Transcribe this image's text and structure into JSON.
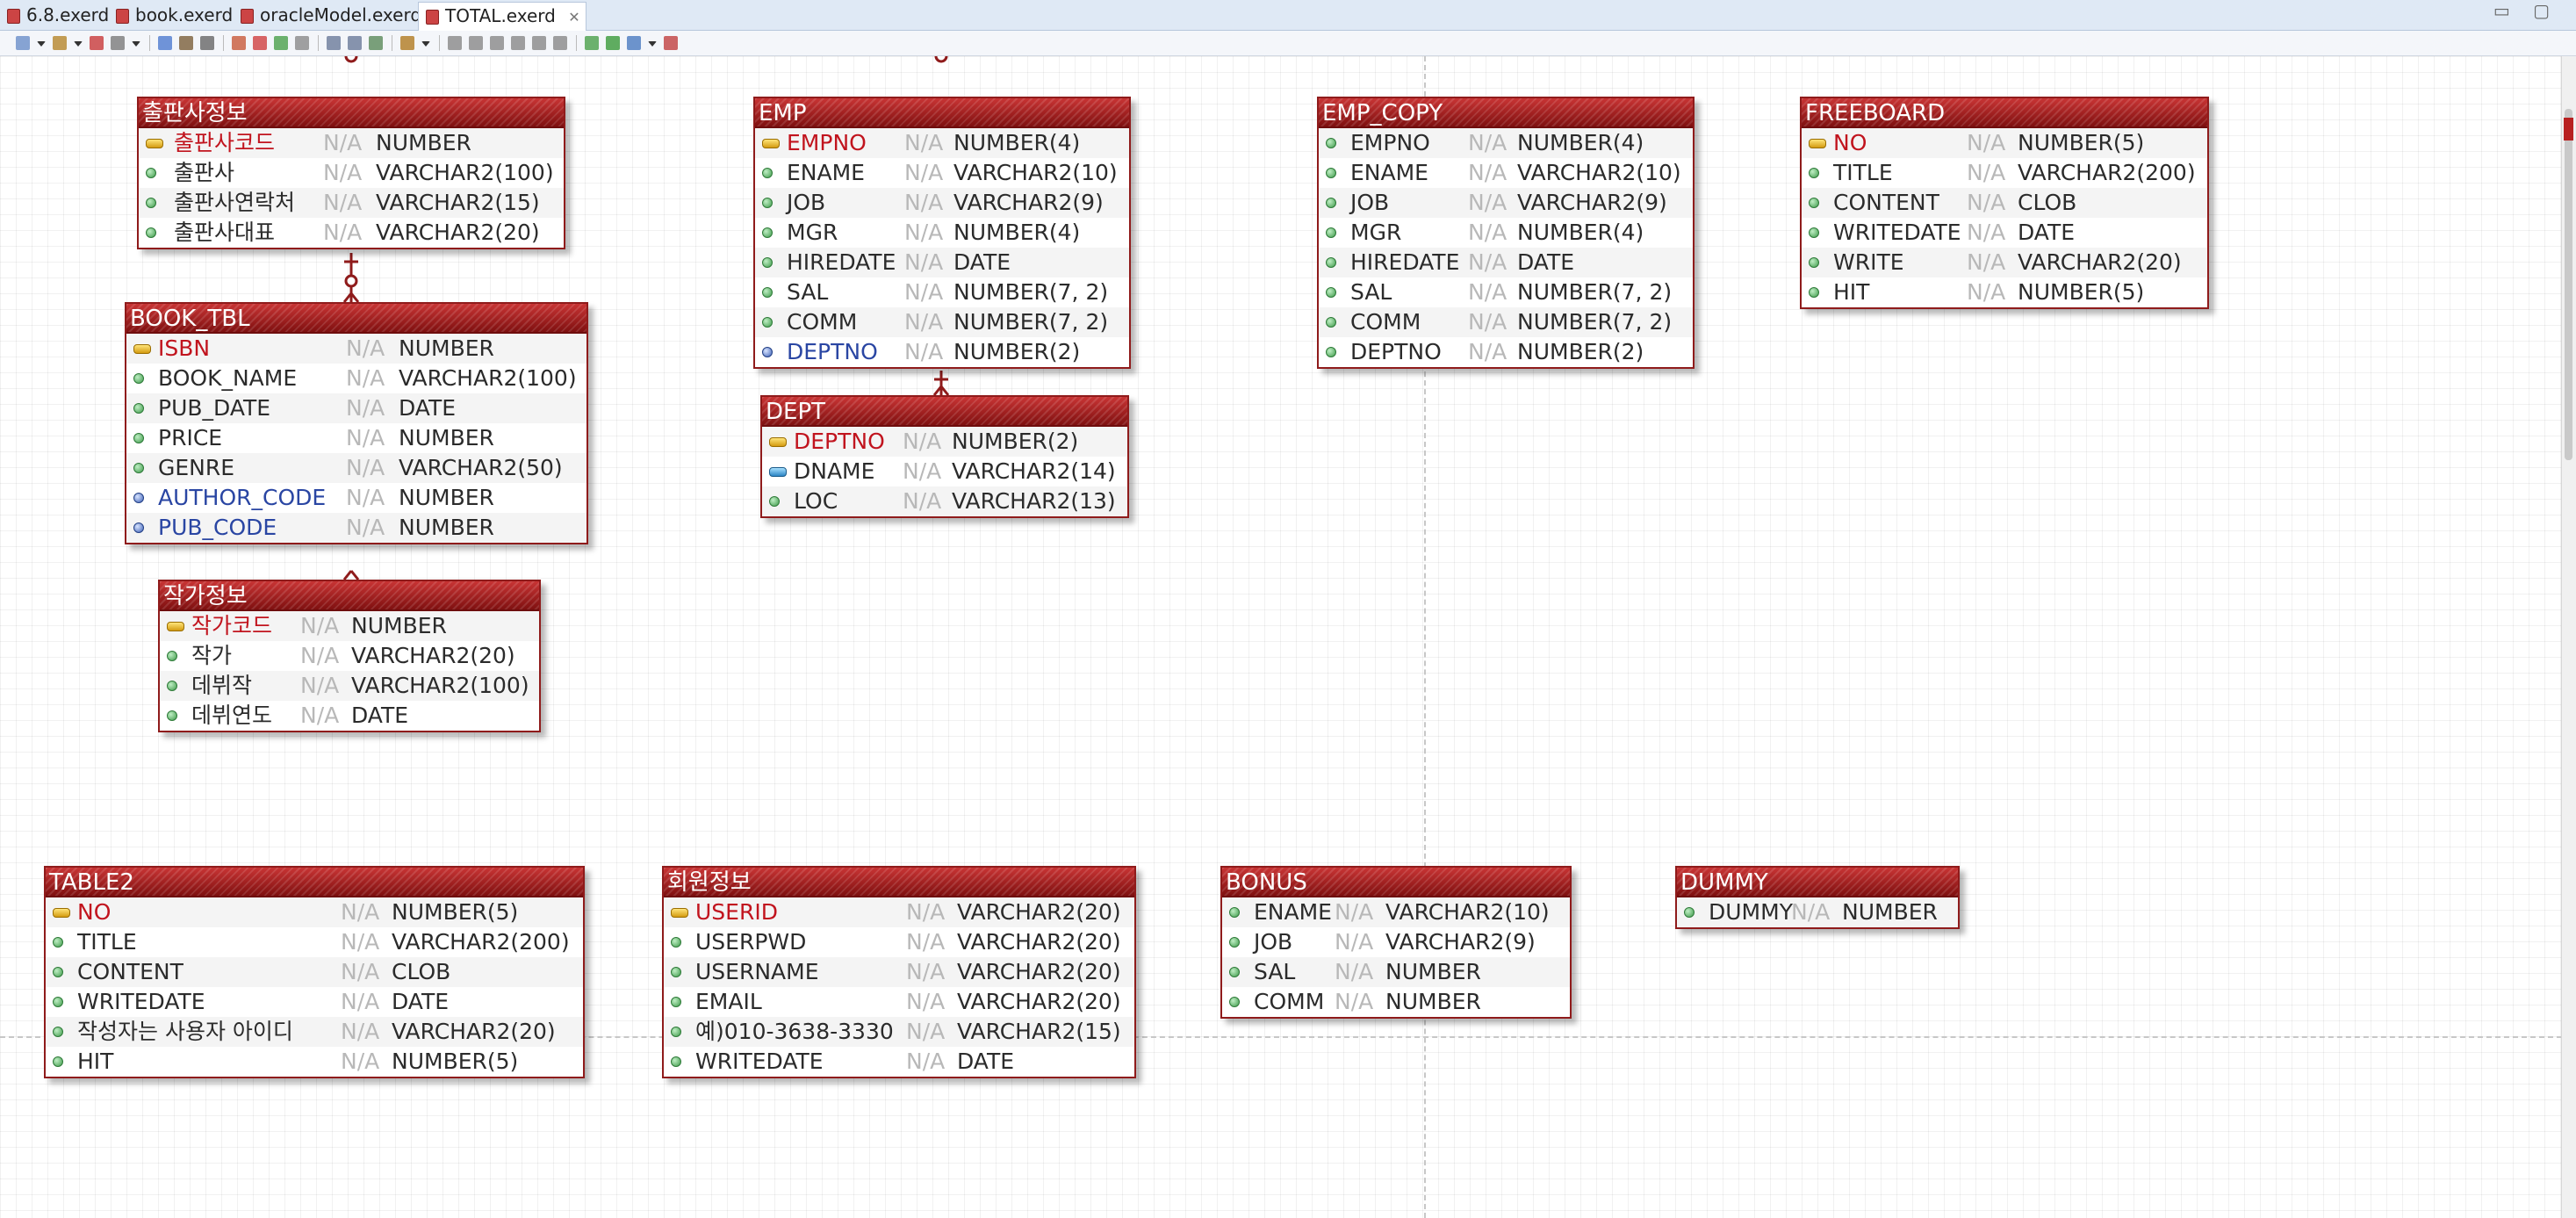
{
  "tabs": [
    {
      "label": "6.8.exerd",
      "active": false
    },
    {
      "label": "book.exerd",
      "active": false
    },
    {
      "label": "oracleModel.exerd",
      "active": false
    },
    {
      "label": "TOTAL.exerd",
      "active": true
    }
  ],
  "tab_close_glyph": "✕",
  "window_controls": "▭ ▢",
  "toolbar_icons": [
    "new-icon",
    "dropdown-icon",
    "connect-icon",
    "dropdown-icon",
    "save-icon",
    "copy-icon",
    "dropdown-icon",
    "select-icon",
    "hand-icon",
    "zoom-icon",
    "table-icon",
    "relation-icon",
    "relation-icon",
    "note-icon",
    "print-icon",
    "print-preview-icon",
    "image-icon",
    "layout-icon",
    "dropdown-icon",
    "align-left-icon",
    "align-center-icon",
    "align-right-icon",
    "align-top-icon",
    "align-middle-icon",
    "align-bottom-icon",
    "export-icon",
    "generate-icon",
    "sync-icon",
    "dropdown-icon",
    "settings-icon"
  ],
  "null_label": "N/A",
  "entities": [
    {
      "id": "publisher",
      "title": "출판사정보",
      "columns": [
        {
          "key": "pk",
          "name": "출판사코드",
          "type": "NUMBER"
        },
        {
          "key": "attr",
          "name": "출판사",
          "type": "VARCHAR2(100)"
        },
        {
          "key": "attr",
          "name": "출판사연락처",
          "type": "VARCHAR2(15)"
        },
        {
          "key": "attr",
          "name": "출판사대표",
          "type": "VARCHAR2(20)"
        }
      ]
    },
    {
      "id": "book-tbl",
      "title": "BOOK_TBL",
      "columns": [
        {
          "key": "pk",
          "name": "ISBN",
          "type": "NUMBER"
        },
        {
          "key": "attr",
          "name": "BOOK_NAME",
          "type": "VARCHAR2(100)"
        },
        {
          "key": "attr",
          "name": "PUB_DATE",
          "type": "DATE"
        },
        {
          "key": "attr",
          "name": "PRICE",
          "type": "NUMBER"
        },
        {
          "key": "attr",
          "name": "GENRE",
          "type": "VARCHAR2(50)"
        },
        {
          "key": "fk",
          "name": "AUTHOR_CODE",
          "type": "NUMBER"
        },
        {
          "key": "fk",
          "name": "PUB_CODE",
          "type": "NUMBER"
        }
      ]
    },
    {
      "id": "author",
      "title": "작가정보",
      "columns": [
        {
          "key": "pk",
          "name": "작가코드",
          "type": "NUMBER"
        },
        {
          "key": "attr",
          "name": "작가",
          "type": "VARCHAR2(20)"
        },
        {
          "key": "attr",
          "name": "데뷔작",
          "type": "VARCHAR2(100)"
        },
        {
          "key": "attr",
          "name": "데뷔연도",
          "type": "DATE"
        }
      ]
    },
    {
      "id": "emp",
      "title": "EMP",
      "columns": [
        {
          "key": "pk",
          "name": "EMPNO",
          "type": "NUMBER(4)"
        },
        {
          "key": "attr",
          "name": "ENAME",
          "type": "VARCHAR2(10)"
        },
        {
          "key": "attr",
          "name": "JOB",
          "type": "VARCHAR2(9)"
        },
        {
          "key": "attr",
          "name": "MGR",
          "type": "NUMBER(4)"
        },
        {
          "key": "attr",
          "name": "HIREDATE",
          "type": "DATE"
        },
        {
          "key": "attr",
          "name": "SAL",
          "type": "NUMBER(7, 2)"
        },
        {
          "key": "attr",
          "name": "COMM",
          "type": "NUMBER(7, 2)"
        },
        {
          "key": "fk",
          "name": "DEPTNO",
          "type": "NUMBER(2)"
        }
      ]
    },
    {
      "id": "dept",
      "title": "DEPT",
      "columns": [
        {
          "key": "pk",
          "name": "DEPTNO",
          "type": "NUMBER(2)"
        },
        {
          "key": "ak",
          "name": "DNAME",
          "type": "VARCHAR2(14)"
        },
        {
          "key": "attr",
          "name": "LOC",
          "type": "VARCHAR2(13)"
        }
      ]
    },
    {
      "id": "emp-copy",
      "title": "EMP_COPY",
      "columns": [
        {
          "key": "attr",
          "name": "EMPNO",
          "type": "NUMBER(4)"
        },
        {
          "key": "attr",
          "name": "ENAME",
          "type": "VARCHAR2(10)"
        },
        {
          "key": "attr",
          "name": "JOB",
          "type": "VARCHAR2(9)"
        },
        {
          "key": "attr",
          "name": "MGR",
          "type": "NUMBER(4)"
        },
        {
          "key": "attr",
          "name": "HIREDATE",
          "type": "DATE"
        },
        {
          "key": "attr",
          "name": "SAL",
          "type": "NUMBER(7, 2)"
        },
        {
          "key": "attr",
          "name": "COMM",
          "type": "NUMBER(7, 2)"
        },
        {
          "key": "attr",
          "name": "DEPTNO",
          "type": "NUMBER(2)"
        }
      ]
    },
    {
      "id": "freeboard",
      "title": "FREEBOARD",
      "columns": [
        {
          "key": "pk",
          "name": "NO",
          "type": "NUMBER(5)"
        },
        {
          "key": "attr",
          "name": "TITLE",
          "type": "VARCHAR2(200)"
        },
        {
          "key": "attr",
          "name": "CONTENT",
          "type": "CLOB"
        },
        {
          "key": "attr",
          "name": "WRITEDATE",
          "type": "DATE"
        },
        {
          "key": "attr",
          "name": "WRITE",
          "type": "VARCHAR2(20)"
        },
        {
          "key": "attr",
          "name": "HIT",
          "type": "NUMBER(5)"
        }
      ]
    },
    {
      "id": "table2",
      "title": "TABLE2",
      "columns": [
        {
          "key": "pk",
          "name": "NO",
          "type": "NUMBER(5)"
        },
        {
          "key": "attr",
          "name": "TITLE",
          "type": "VARCHAR2(200)"
        },
        {
          "key": "attr",
          "name": "CONTENT",
          "type": "CLOB"
        },
        {
          "key": "attr",
          "name": "WRITEDATE",
          "type": "DATE"
        },
        {
          "key": "attr",
          "name": "작성자는 사용자 아이디",
          "type": "VARCHAR2(20)"
        },
        {
          "key": "attr",
          "name": "HIT",
          "type": "NUMBER(5)"
        }
      ]
    },
    {
      "id": "member",
      "title": "회원정보",
      "columns": [
        {
          "key": "pk",
          "name": "USERID",
          "type": "VARCHAR2(20)"
        },
        {
          "key": "attr",
          "name": "USERPWD",
          "type": "VARCHAR2(20)"
        },
        {
          "key": "attr",
          "name": "USERNAME",
          "type": "VARCHAR2(20)"
        },
        {
          "key": "attr",
          "name": "EMAIL",
          "type": "VARCHAR2(20)"
        },
        {
          "key": "attr",
          "name": "예)010-3638-3330",
          "type": "VARCHAR2(15)"
        },
        {
          "key": "attr",
          "name": "WRITEDATE",
          "type": "DATE"
        }
      ]
    },
    {
      "id": "bonus",
      "title": "BONUS",
      "columns": [
        {
          "key": "attr",
          "name": "ENAME",
          "type": "VARCHAR2(10)"
        },
        {
          "key": "attr",
          "name": "JOB",
          "type": "VARCHAR2(9)"
        },
        {
          "key": "attr",
          "name": "SAL",
          "type": "NUMBER"
        },
        {
          "key": "attr",
          "name": "COMM",
          "type": "NUMBER"
        }
      ]
    },
    {
      "id": "dummy",
      "title": "DUMMY",
      "columns": [
        {
          "key": "attr",
          "name": "DUMMY",
          "type": "NUMBER"
        }
      ]
    }
  ],
  "colors": {
    "entity_header": "#a81e1e",
    "pk_text": "#c1141e",
    "fk_text": "#2a46a3",
    "null_text": "#b8b8b8",
    "relation": "#8f1b1b"
  }
}
